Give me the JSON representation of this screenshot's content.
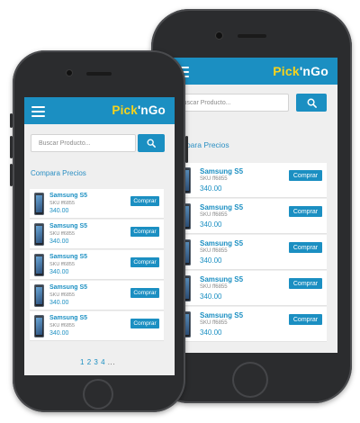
{
  "app": {
    "logo_part1": "Pick",
    "logo_part2": "'nGo"
  },
  "search": {
    "placeholder": "Buscar Producto..."
  },
  "section": {
    "title": "Compara Precios"
  },
  "products": [
    {
      "name": "Samsung S5",
      "sku": "SKU ff6855",
      "price": "340.00",
      "button": "Comprar"
    },
    {
      "name": "Samsung S5",
      "sku": "SKU ff6855",
      "price": "340.00",
      "button": "Comprar"
    },
    {
      "name": "Samsung S5",
      "sku": "SKU ff6855",
      "price": "340.00",
      "button": "Comprar"
    },
    {
      "name": "Samsung S5",
      "sku": "SKU ff6855",
      "price": "340.00",
      "button": "Comprar"
    },
    {
      "name": "Samsung S5",
      "sku": "SKU ff6855",
      "price": "340.00",
      "button": "Comprar"
    }
  ],
  "pagination": {
    "pages": [
      "1",
      "2",
      "3",
      "4"
    ],
    "ellipsis": "..."
  },
  "colors": {
    "brand_blue": "#1b8fc2",
    "logo_yellow": "#f7d31c",
    "screen_bg": "#efefef"
  },
  "icons": {
    "menu": "hamburger-menu-icon",
    "search": "search-icon"
  }
}
